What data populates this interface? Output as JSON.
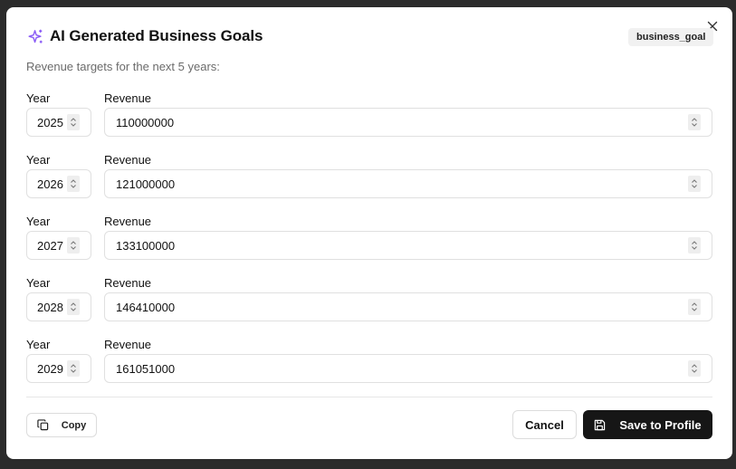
{
  "dialog": {
    "title": "AI Generated Business Goals",
    "badge": "business_goal",
    "subtitle": "Revenue targets for the next 5 years:",
    "year_label": "Year",
    "revenue_label": "Revenue",
    "rows": [
      {
        "year": "2025",
        "revenue": "110000000"
      },
      {
        "year": "2026",
        "revenue": "121000000"
      },
      {
        "year": "2027",
        "revenue": "133100000"
      },
      {
        "year": "2028",
        "revenue": "146410000"
      },
      {
        "year": "2029",
        "revenue": "161051000"
      }
    ],
    "copy_label": "Copy",
    "cancel_label": "Cancel",
    "save_label": "Save to Profile"
  },
  "icons": {
    "title_icon": "sparkles-icon",
    "close_icon": "close-icon",
    "copy_icon": "copy-icon",
    "save_icon": "floppy-disk-icon",
    "spinner_icon": "chevron-up-down-icon"
  },
  "colors": {
    "accent": "#8b5cf6",
    "primary_button": "#161616",
    "backdrop": "#2b2b2b"
  }
}
